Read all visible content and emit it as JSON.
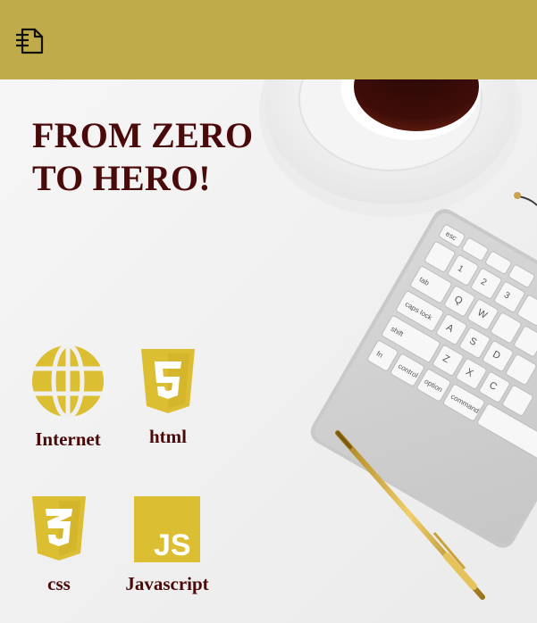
{
  "header": {
    "menu_icon": "file-menu-icon",
    "background_color": "#bfab4a"
  },
  "hero": {
    "title_line1": "FROM ZERO",
    "title_line2": "TO HERO!",
    "title_color": "#4b0a0a",
    "image_description_icons": [
      "coffee-cup",
      "keyboard",
      "pen"
    ]
  },
  "skills": [
    {
      "label": "Internet",
      "icon": "globe-icon"
    },
    {
      "label": "html",
      "icon": "html5-icon"
    },
    {
      "label": "css",
      "icon": "css3-icon"
    },
    {
      "label": "Javascript",
      "icon": "javascript-icon"
    }
  ],
  "icon_color": "#dcbe32",
  "keyboard_keys": {
    "esc": "esc",
    "tab": "tab",
    "caps": "caps lock",
    "shift": "shift",
    "fn": "fn",
    "control": "control",
    "option": "option",
    "command": "command",
    "q": "Q",
    "w": "W",
    "a": "A",
    "s": "S",
    "d": "D",
    "z": "Z",
    "x": "X",
    "c": "C",
    "one": "1",
    "two": "2",
    "three": "3"
  }
}
